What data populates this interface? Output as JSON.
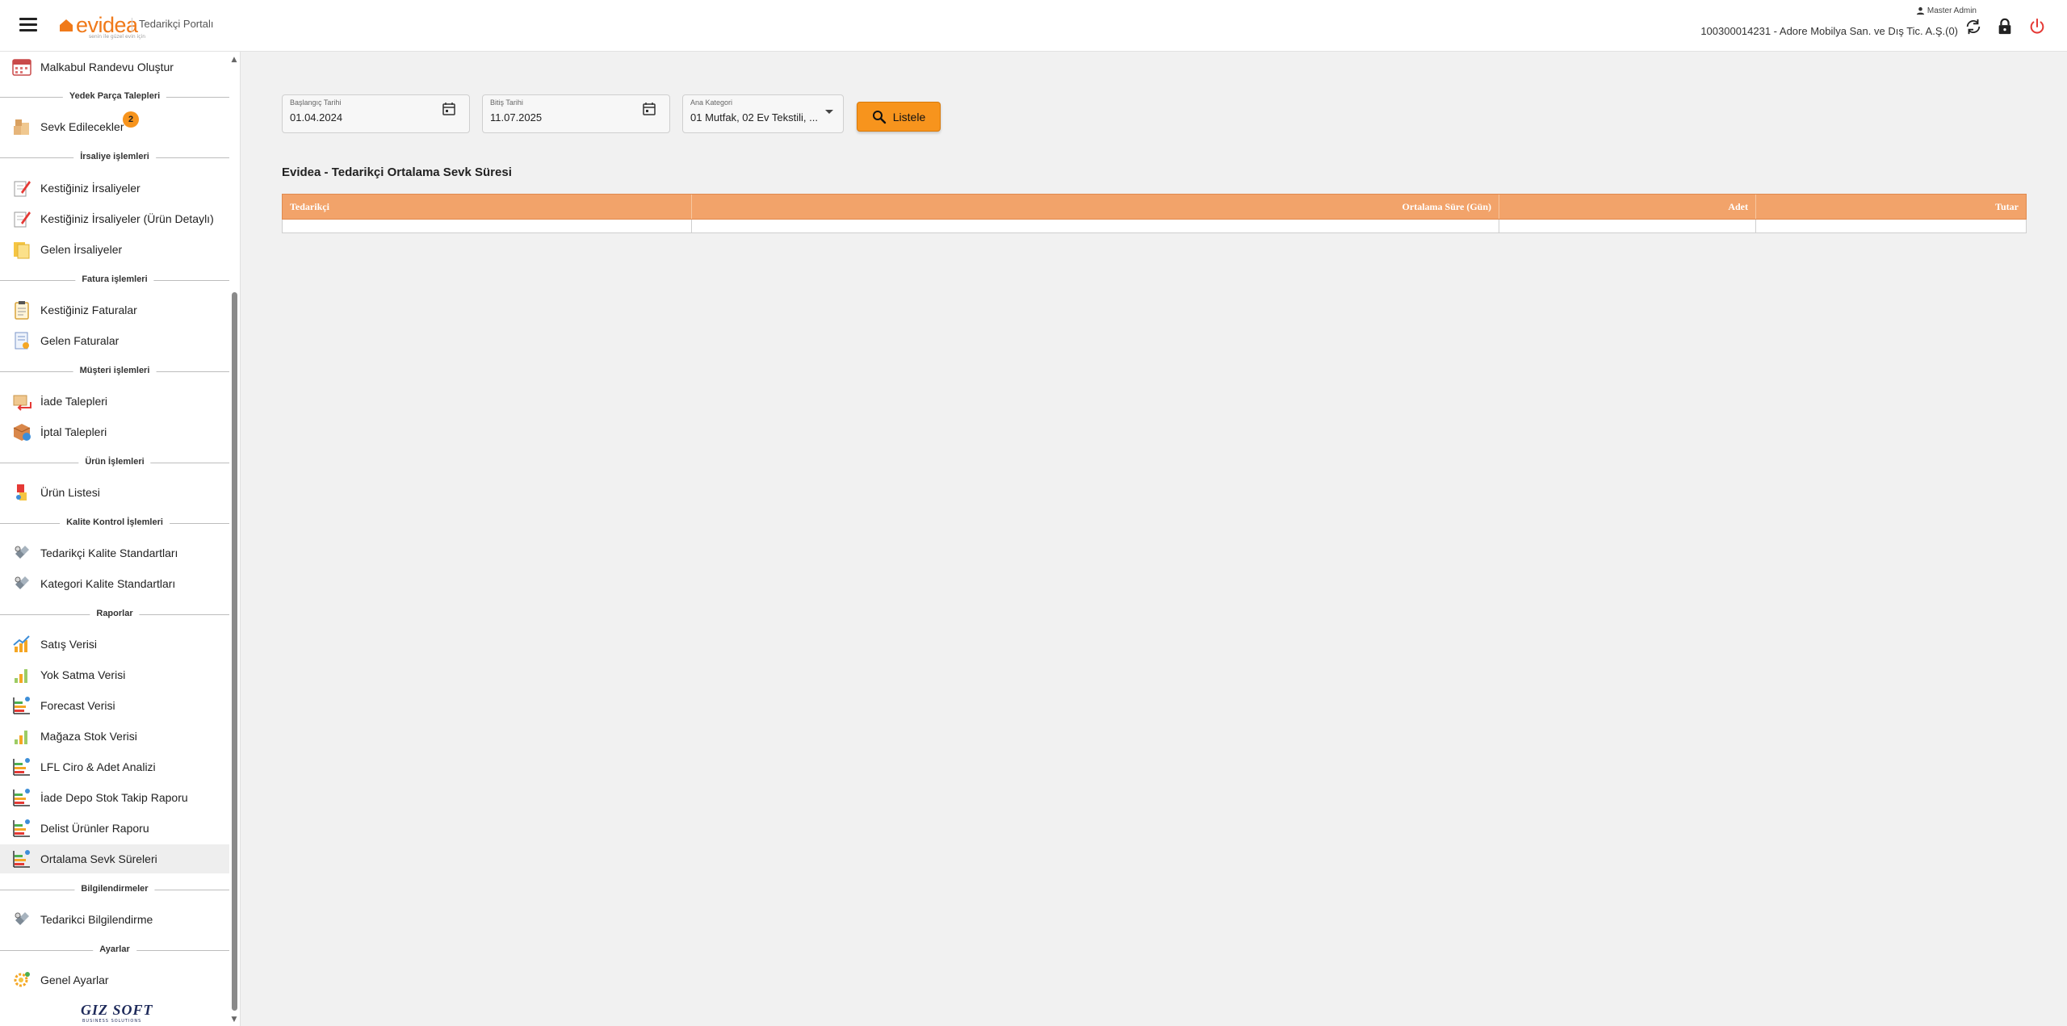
{
  "header": {
    "logo_text": "evidea",
    "logo_tagline": "senin ile güzel evin için",
    "portal_title": "Tedarikçi Portalı",
    "user_name": "Master Admin",
    "company": "100300014231 - Adore Mobilya San. ve Dış Tic. A.Ş.(0)",
    "icons": [
      "menu-icon",
      "user-icon",
      "refresh-icon",
      "lock-icon",
      "power-icon"
    ]
  },
  "sidebar": {
    "items": [
      {
        "label": "Malkabul Randevu Oluştur",
        "icon": "calendar-icon"
      },
      {
        "label": "Sevk Edilecekler",
        "icon": "boxes-icon",
        "badge": "2"
      },
      {
        "label": "Kestiğiniz İrsaliyeler",
        "icon": "edit-document-icon"
      },
      {
        "label": "Kestiğiniz İrsaliyeler (Ürün Detaylı)",
        "icon": "edit-document-icon"
      },
      {
        "label": "Gelen İrsaliyeler",
        "icon": "documents-icon"
      },
      {
        "label": "Kestiğiniz Faturalar",
        "icon": "clipboard-icon"
      },
      {
        "label": "Gelen Faturalar",
        "icon": "invoice-icon"
      },
      {
        "label": "İade Talepleri",
        "icon": "return-icon"
      },
      {
        "label": "İptal Talepleri",
        "icon": "cancel-box-icon"
      },
      {
        "label": "Ürün Listesi",
        "icon": "products-icon"
      },
      {
        "label": "Tedarikçi Kalite Standartları",
        "icon": "quality-icon"
      },
      {
        "label": "Kategori Kalite Standartları",
        "icon": "quality-icon"
      },
      {
        "label": "Satış Verisi",
        "icon": "chart-up-icon"
      },
      {
        "label": "Yok Satma Verisi",
        "icon": "bar-chart-icon"
      },
      {
        "label": "Forecast Verisi",
        "icon": "report-chart-icon"
      },
      {
        "label": "Mağaza Stok Verisi",
        "icon": "bar-chart-icon"
      },
      {
        "label": "LFL Ciro & Adet Analizi",
        "icon": "report-chart-icon"
      },
      {
        "label": "İade Depo Stok Takip Raporu",
        "icon": "report-chart-icon"
      },
      {
        "label": "Delist Ürünler Raporu",
        "icon": "report-chart-icon"
      },
      {
        "label": "Ortalama Sevk Süreleri",
        "icon": "report-chart-icon"
      },
      {
        "label": "Tedarikci Bilgilendirme",
        "icon": "quality-icon"
      },
      {
        "label": "Genel Ayarlar",
        "icon": "settings-icon"
      }
    ],
    "sections": [
      "Yedek Parça Talepleri",
      "İrsaliye işlemleri",
      "Fatura işlemleri",
      "Müşteri işlemleri",
      "Ürün İşlemleri",
      "Kalite Kontrol İşlemleri",
      "Raporlar",
      "Bilgilendirmeler",
      "Ayarlar"
    ],
    "footer_logo": "GIZ SOFT",
    "footer_sub": "BUSINESS SOLUTIONS"
  },
  "filters": {
    "start_label": "Başlangıç Tarihi",
    "start_value": "01.04.2024",
    "end_label": "Bitiş Tarihi",
    "end_value": "11.07.2025",
    "category_label": "Ana Kategori",
    "category_value": "01 Mutfak, 02 Ev Tekstili, ...",
    "list_button": "Listele"
  },
  "report": {
    "title": "Evidea - Tedarikçi Ortalama Sevk Süresi",
    "columns": [
      "Tedarikçi",
      "Ortalama Süre (Gün)",
      "Adet",
      "Tutar"
    ],
    "rows": []
  },
  "colors": {
    "accent": "#f7941d",
    "table_header": "#f2a36a",
    "logo": "#f07a1a",
    "power": "#e53935"
  }
}
